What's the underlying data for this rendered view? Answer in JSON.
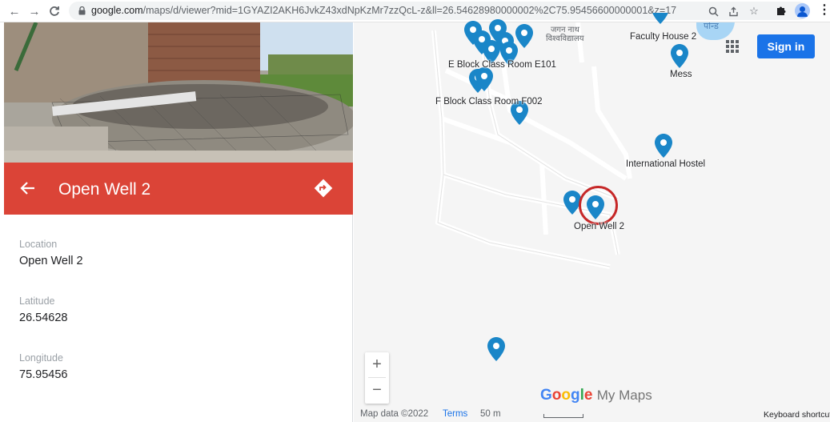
{
  "browser": {
    "url_host": "google.com",
    "url_path": "/maps/d/viewer?mid=1GYAZI2AKH6JvkZ43xdNpKzMr7zzQcL-z&ll=26.54628980000002%2C75.95456600000001&z=17"
  },
  "panel": {
    "title": "Open Well 2",
    "header_color": "#db4437",
    "fields": [
      {
        "label": "Location",
        "value": "Open Well 2"
      },
      {
        "label": "Latitude",
        "value": "26.54628"
      },
      {
        "label": "Longitude",
        "value": "75.95456"
      }
    ]
  },
  "map": {
    "labels": {
      "e_block": "E Block Class Room E101",
      "f_block": "F Block Class Room F002",
      "faculty": "Faculty House 2",
      "mess": "Mess",
      "intl_hostel": "International Hostel",
      "open_well": "Open Well 2",
      "hindi_top": "जगन नाथ",
      "hindi_sub": "विश्वविद्यालय",
      "pond": "पोन्ड"
    },
    "pin_color": "#1a86c8",
    "highlight_color": "#c62828",
    "signin_label": "Sign in",
    "zoom_in": "+",
    "zoom_out": "−",
    "brand_google": "Google",
    "brand_suffix": "My Maps",
    "footer": {
      "map_data": "Map data ©2022",
      "terms": "Terms",
      "scale": "50 m",
      "shortcuts": "Keyboard shortcut"
    }
  }
}
